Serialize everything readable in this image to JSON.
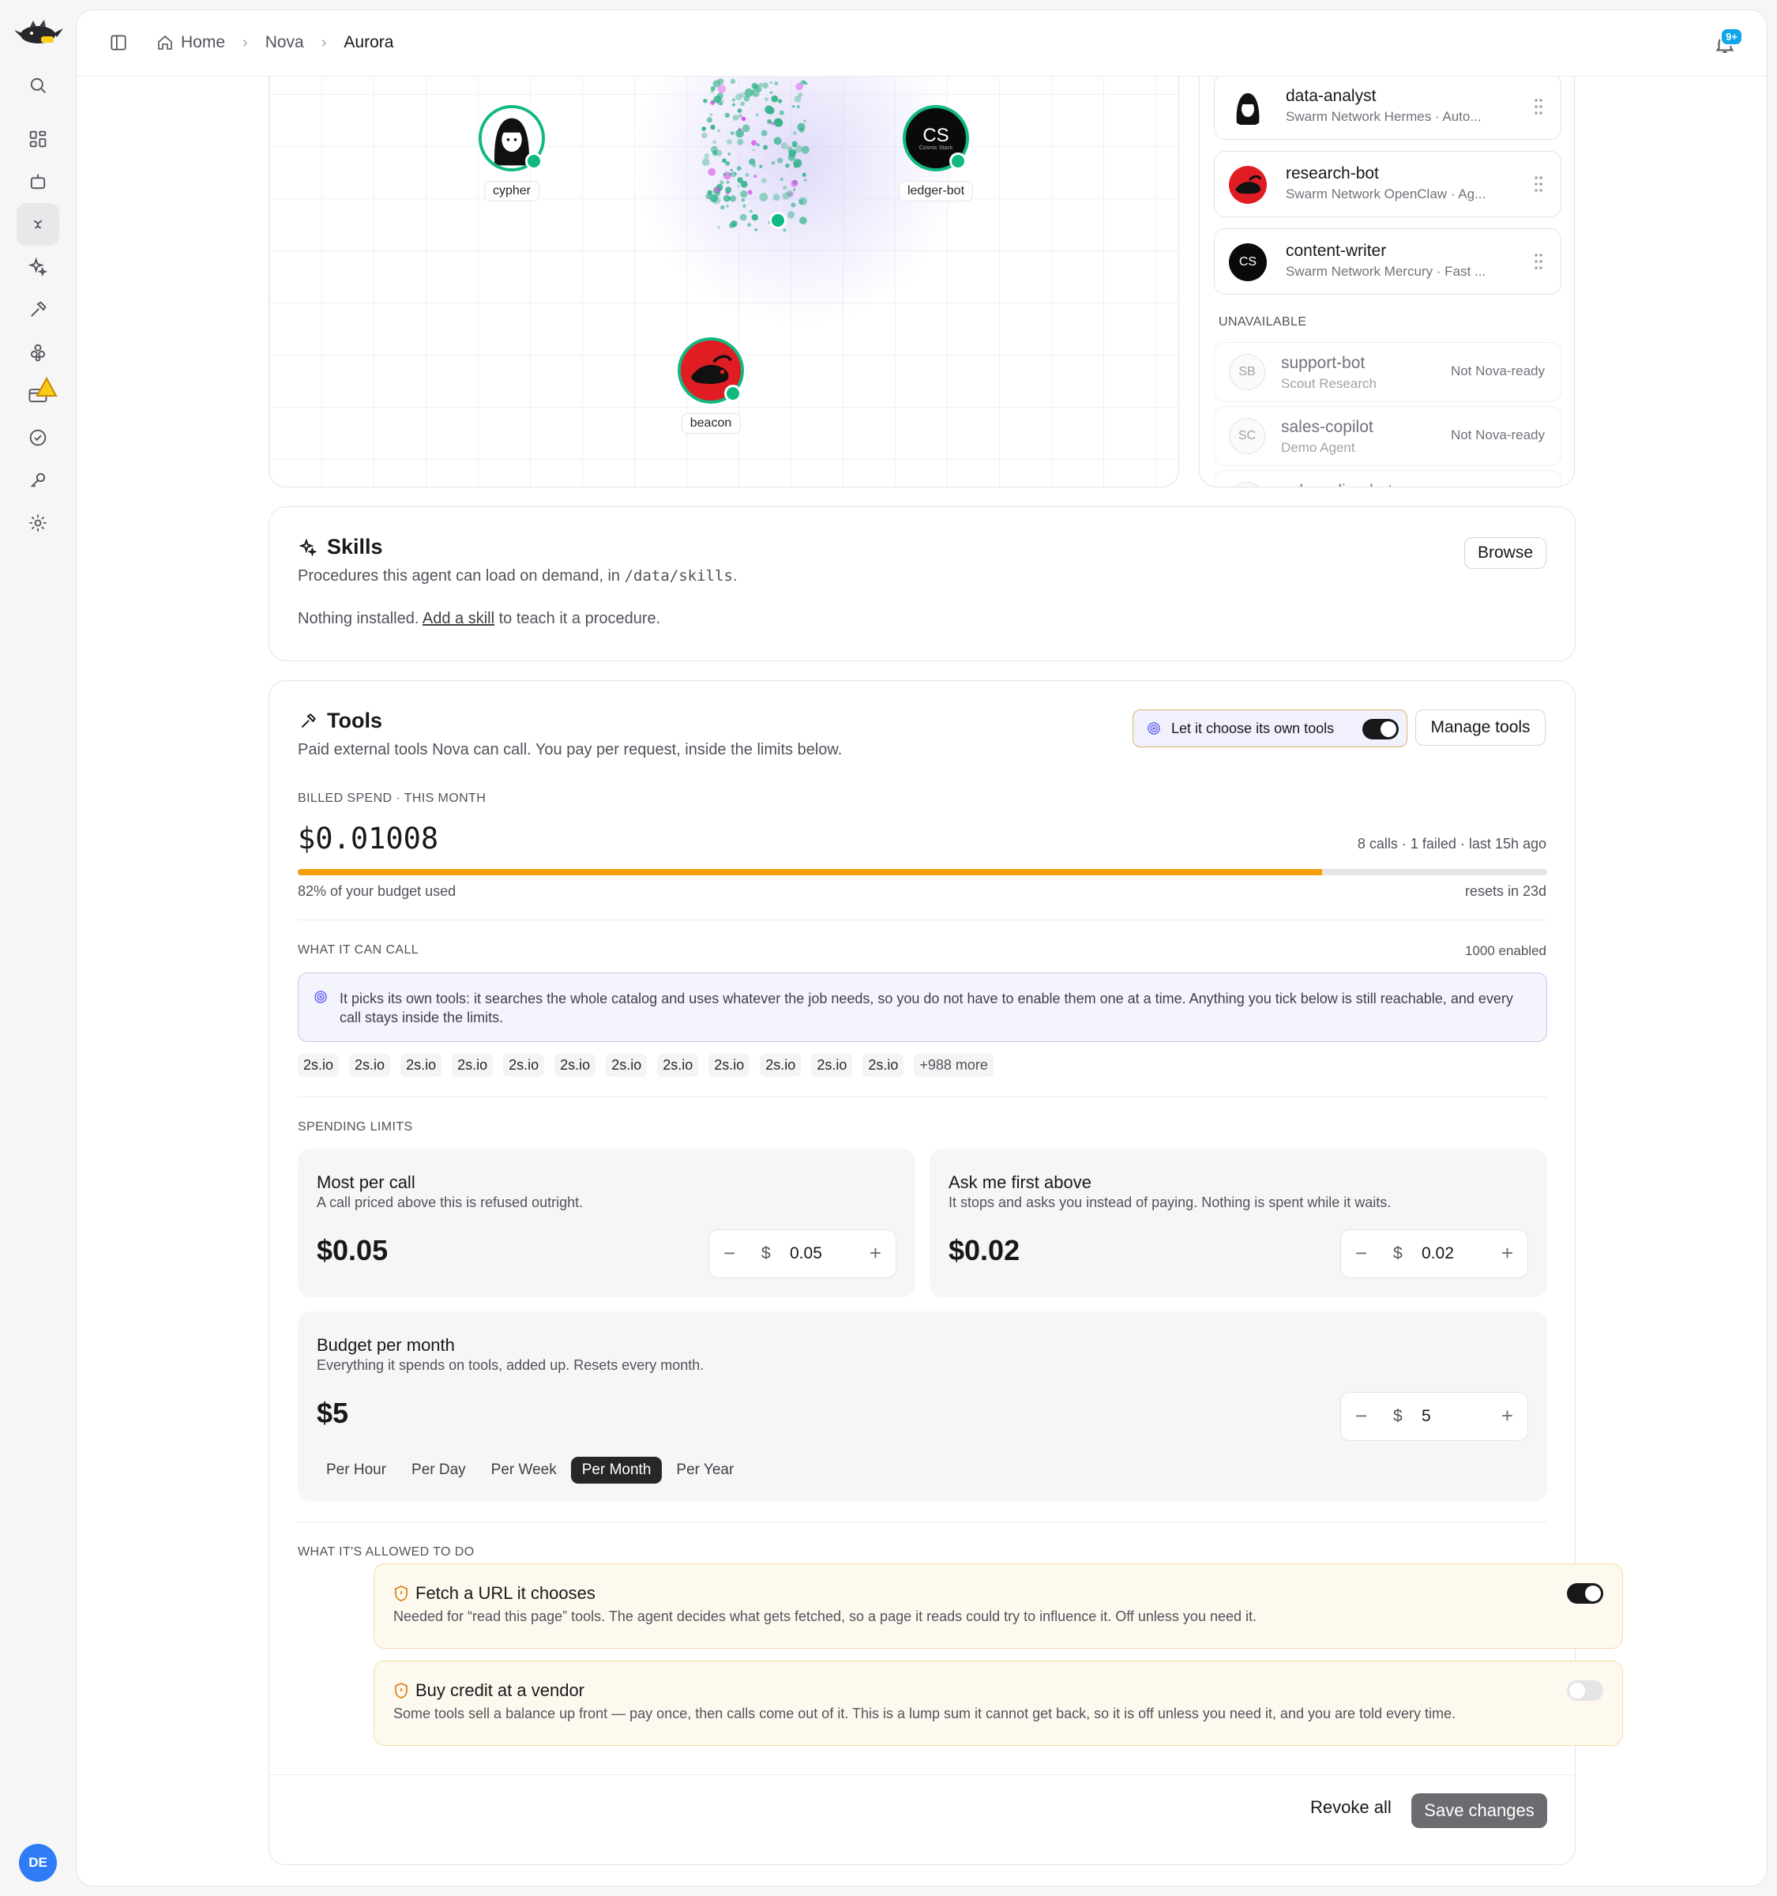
{
  "breadcrumb": {
    "home": "Home",
    "parent": "Nova",
    "current": "Aurora"
  },
  "notifications": {
    "badge": "9+"
  },
  "sidebar": {
    "avatar_initials": "DE"
  },
  "graph": {
    "nodes": [
      {
        "label": "cypher"
      },
      {
        "label": "ledger-bot",
        "initials": "CS",
        "sub": "Cosmic Stack"
      },
      {
        "label": "beacon"
      }
    ]
  },
  "agents": {
    "available": [
      {
        "name": "data-analyst",
        "sub": "Swarm Network Hermes · Auto..."
      },
      {
        "name": "research-bot",
        "sub": "Swarm Network OpenClaw · Ag..."
      },
      {
        "name": "content-writer",
        "sub": "Swarm Network Mercury · Fast ...",
        "initials": "CS"
      }
    ],
    "unavailable_heading": "UNAVAILABLE",
    "unavailable": [
      {
        "initials": "SB",
        "name": "support-bot",
        "sub": "Scout Research",
        "tag": "Not Nova-ready"
      },
      {
        "initials": "SC",
        "name": "sales-copilot",
        "sub": "Demo Agent",
        "tag": "Not Nova-ready"
      },
      {
        "name": "onboarding-bot"
      }
    ]
  },
  "skills": {
    "title": "Skills",
    "desc_prefix": "Procedures this agent can load on demand, in",
    "path": "/data/skills",
    "desc_suffix": ".",
    "browse": "Browse",
    "empty_prefix": "Nothing installed.",
    "empty_link": "Add a skill",
    "empty_suffix": "to teach it a procedure."
  },
  "tools": {
    "title": "Tools",
    "desc": "Paid external tools Nova can call. You pay per request, inside the limits below.",
    "auto_label": "Let it choose its own tools",
    "manage": "Manage tools",
    "billed_heading": "BILLED SPEND · THIS MONTH",
    "spend": "$0.01008",
    "calls": "8 calls · 1 failed · last 15h ago",
    "budget_used_pct": 82,
    "budget_used_text": "82% of your budget used",
    "resets": "resets in 23d",
    "can_call_heading": "WHAT IT CAN CALL",
    "enabled_count": "1000 enabled",
    "info": "It picks its own tools: it searches the whole catalog and uses whatever the job needs, so you do not have to enable them one at a time. Anything you tick below is still reachable, and every call stays inside the limits.",
    "chips": [
      "2s.io",
      "2s.io",
      "2s.io",
      "2s.io",
      "2s.io",
      "2s.io",
      "2s.io",
      "2s.io",
      "2s.io",
      "2s.io",
      "2s.io",
      "2s.io"
    ],
    "more": "+988 more",
    "limits_heading": "SPENDING LIMITS",
    "per_call": {
      "title": "Most per call",
      "desc": "A call priced above this is refused outright.",
      "value": "$0.05",
      "currency": "$",
      "input": "0.05"
    },
    "ask_first": {
      "title": "Ask me first above",
      "desc": "It stops and asks you instead of paying. Nothing is spent while it waits.",
      "value": "$0.02",
      "currency": "$",
      "input": "0.02"
    },
    "budget": {
      "title": "Budget per month",
      "desc": "Everything it spends on tools, added up. Resets every month.",
      "value": "$5",
      "currency": "$",
      "input": "5"
    },
    "periods": [
      "Per Hour",
      "Per Day",
      "Per Week",
      "Per Month",
      "Per Year"
    ],
    "selected_period": "Per Month",
    "allowed_heading": "WHAT IT'S ALLOWED TO DO",
    "permissions": [
      {
        "title": "Fetch a URL it chooses",
        "desc": "Needed for “read this page” tools. The agent decides what gets fetched, so a page it reads could try to influence it. Off unless you need it.",
        "enabled": true
      },
      {
        "title": "Buy credit at a vendor",
        "desc": "Some tools sell a balance up front — pay once, then calls come out of it. This is a lump sum it cannot get back, so it is off unless you need it, and you are told every time.",
        "enabled": false
      }
    ],
    "revoke": "Revoke all",
    "save": "Save changes"
  },
  "colors": {
    "accent": "#10b981",
    "budget_bar": "#f59e0b",
    "info_bg": "#f4f4fd",
    "warn_bg": "#fef9ef"
  }
}
